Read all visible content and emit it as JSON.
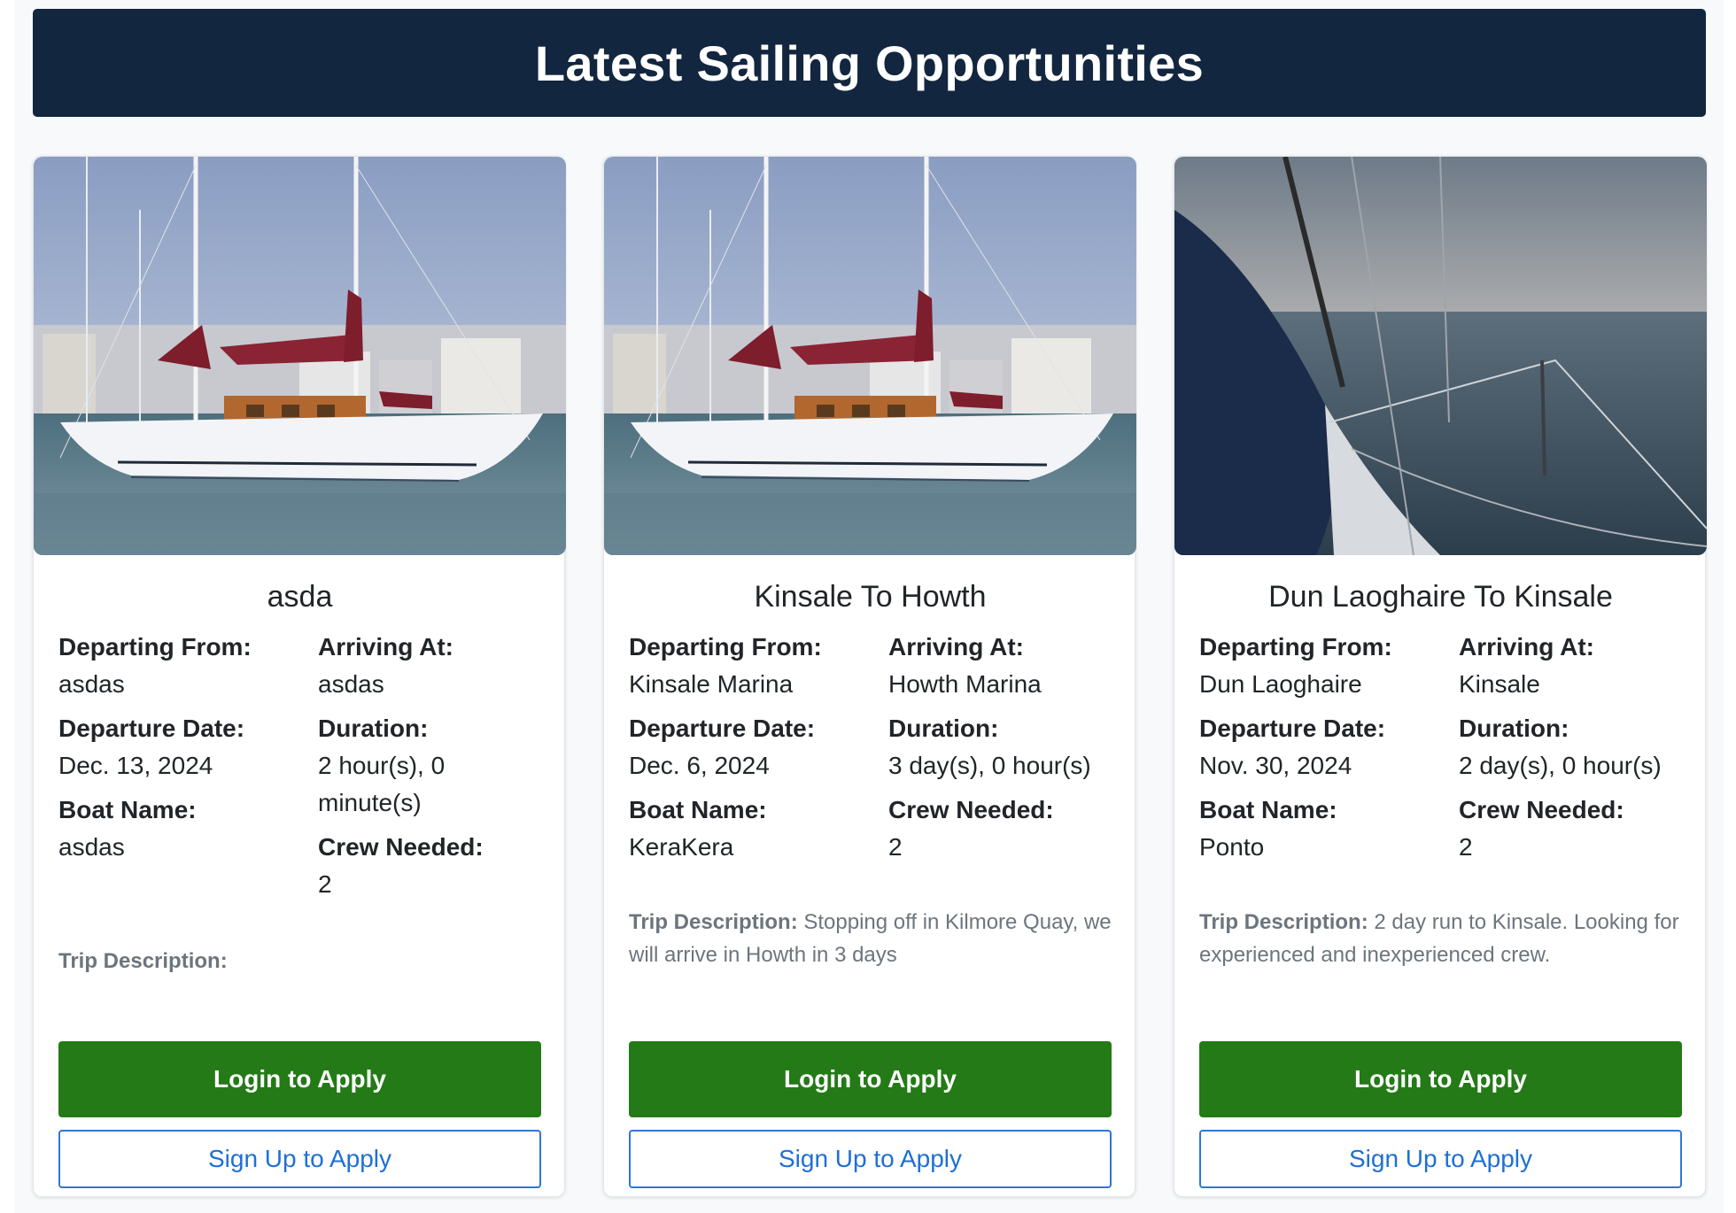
{
  "header": {
    "title": "Latest Sailing Opportunities"
  },
  "labels": {
    "departing_from": "Departing From:",
    "arriving_at": "Arriving At:",
    "departure_date": "Departure Date:",
    "duration": "Duration:",
    "boat_name": "Boat Name:",
    "crew_needed": "Crew Needed:",
    "trip_description": "Trip Description:",
    "login_button": "Login to Apply",
    "signup_button": "Sign Up to Apply"
  },
  "trips": [
    {
      "title": "asda",
      "image": "marina-sailboat-photo",
      "departing_from": "asdas",
      "arriving_at": "asdas",
      "departure_date": "Dec. 13, 2024",
      "duration": "2 hour(s), 0 minute(s)",
      "boat_name": "asdas",
      "crew_needed": "2",
      "trip_description": ""
    },
    {
      "title": "Kinsale To Howth",
      "image": "marina-sailboat-photo",
      "departing_from": "Kinsale Marina",
      "arriving_at": "Howth Marina",
      "departure_date": "Dec. 6, 2024",
      "duration": "3 day(s), 0 hour(s)",
      "boat_name": "KeraKera",
      "crew_needed": "2",
      "trip_description": "Stopping off in Kilmore Quay, we will arrive in Howth in 3 days"
    },
    {
      "title": "Dun Laoghaire To Kinsale",
      "image": "sea-view-from-deck-photo",
      "departing_from": "Dun Laoghaire",
      "arriving_at": "Kinsale",
      "departure_date": "Nov. 30, 2024",
      "duration": "2 day(s), 0 hour(s)",
      "boat_name": "Ponto",
      "crew_needed": "2",
      "trip_description": "2 day run to Kinsale. Looking for experienced and inexperienced crew."
    }
  ],
  "colors": {
    "banner": "#13263f",
    "login_button": "#237a16",
    "signup_border": "#2f76d8",
    "description_text": "#6c757d"
  }
}
